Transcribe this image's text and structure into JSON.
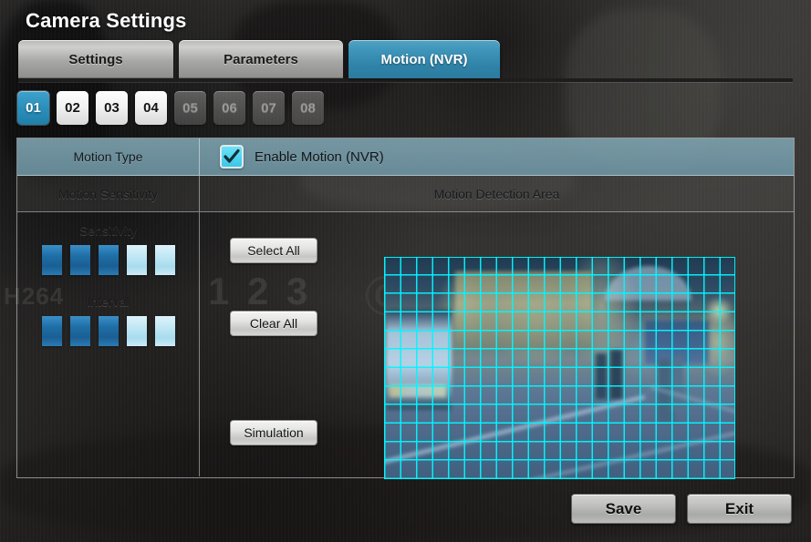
{
  "window": {
    "title": "Camera Settings"
  },
  "tabs": [
    {
      "label": "Settings",
      "active": false
    },
    {
      "label": "Parameters",
      "active": false
    },
    {
      "label": "Motion (NVR)",
      "active": true
    }
  ],
  "channels": [
    {
      "label": "01",
      "state": "active"
    },
    {
      "label": "02",
      "state": "enabled"
    },
    {
      "label": "03",
      "state": "enabled"
    },
    {
      "label": "04",
      "state": "enabled"
    },
    {
      "label": "05",
      "state": "disabled"
    },
    {
      "label": "06",
      "state": "disabled"
    },
    {
      "label": "07",
      "state": "disabled"
    },
    {
      "label": "08",
      "state": "disabled"
    }
  ],
  "motion_type": {
    "label": "Motion Type",
    "checkbox_label": "Enable Motion (NVR)",
    "checked": true
  },
  "sections": {
    "sensitivity_header": "Motion Sensitivity",
    "detection_header": "Motion Detection Area"
  },
  "sliders": [
    {
      "title": "Sensitivity",
      "steps": 5,
      "value": 3
    },
    {
      "title": "Interval",
      "steps": 5,
      "value": 3
    }
  ],
  "area_buttons": [
    {
      "label": "Select All"
    },
    {
      "label": "Clear All"
    },
    {
      "label": "Simulation"
    }
  ],
  "detection_grid": {
    "columns": 22,
    "rows": 12,
    "all_selected": true,
    "line_color": "#00f7ff"
  },
  "footer": {
    "save_label": "Save",
    "exit_label": "Exit"
  },
  "background_watermarks": [
    {
      "text": "H264"
    },
    {
      "text": "1"
    },
    {
      "text": "2"
    },
    {
      "text": "3"
    }
  ],
  "colors": {
    "accent_blue": "#2f82a7",
    "channel_active": "#2c91bd",
    "grid_cyan": "#00f7ff",
    "motion_row": "#6c92a0",
    "checkbox_fill": "#4fd3ef"
  }
}
